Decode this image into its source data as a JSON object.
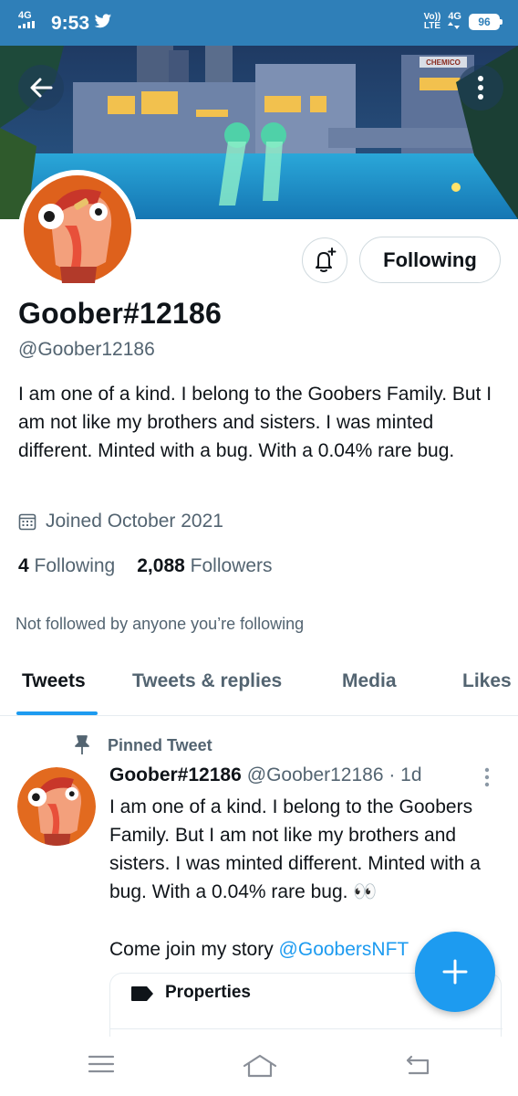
{
  "status_bar": {
    "network_left": "4G",
    "time": "9:53",
    "volte": "Vo))",
    "lte": "LTE",
    "network_right": "4G",
    "battery": "96"
  },
  "banner": {
    "sign_text": "CHEMICO"
  },
  "profile": {
    "name": "Goober#12186",
    "handle": "@Goober12186",
    "bio": "I am one of a kind. I belong to the Goobers Family. But I am not like my brothers and sisters. I was minted different. Minted with a bug. With a 0.04% rare bug.",
    "joined": "Joined October 2021",
    "following_count": "4",
    "following_label": "Following",
    "followers_count": "2,088",
    "followers_label": "Followers",
    "not_followed": "Not followed by anyone you’re following",
    "following_button": "Following"
  },
  "tabs": [
    {
      "label": "Tweets"
    },
    {
      "label": "Tweets & replies"
    },
    {
      "label": "Media"
    },
    {
      "label": "Likes"
    }
  ],
  "tweet": {
    "pinned_label": "Pinned Tweet",
    "name": "Goober#12186",
    "meta": "@Goober12186 · 1d",
    "body": "I am one of a kind. I belong to the Goobers Family. But I am not like my brothers and sisters. I was minted different. Minted with a bug. With a 0.04% rare bug. 👀",
    "line2_prefix": "Come join my story ",
    "mention": "@GoobersNFT",
    "card_label": "Properties"
  },
  "colors": {
    "status_bar": "#2f7fb8",
    "accent": "#1d9bf0",
    "secondary_text": "#536471"
  }
}
